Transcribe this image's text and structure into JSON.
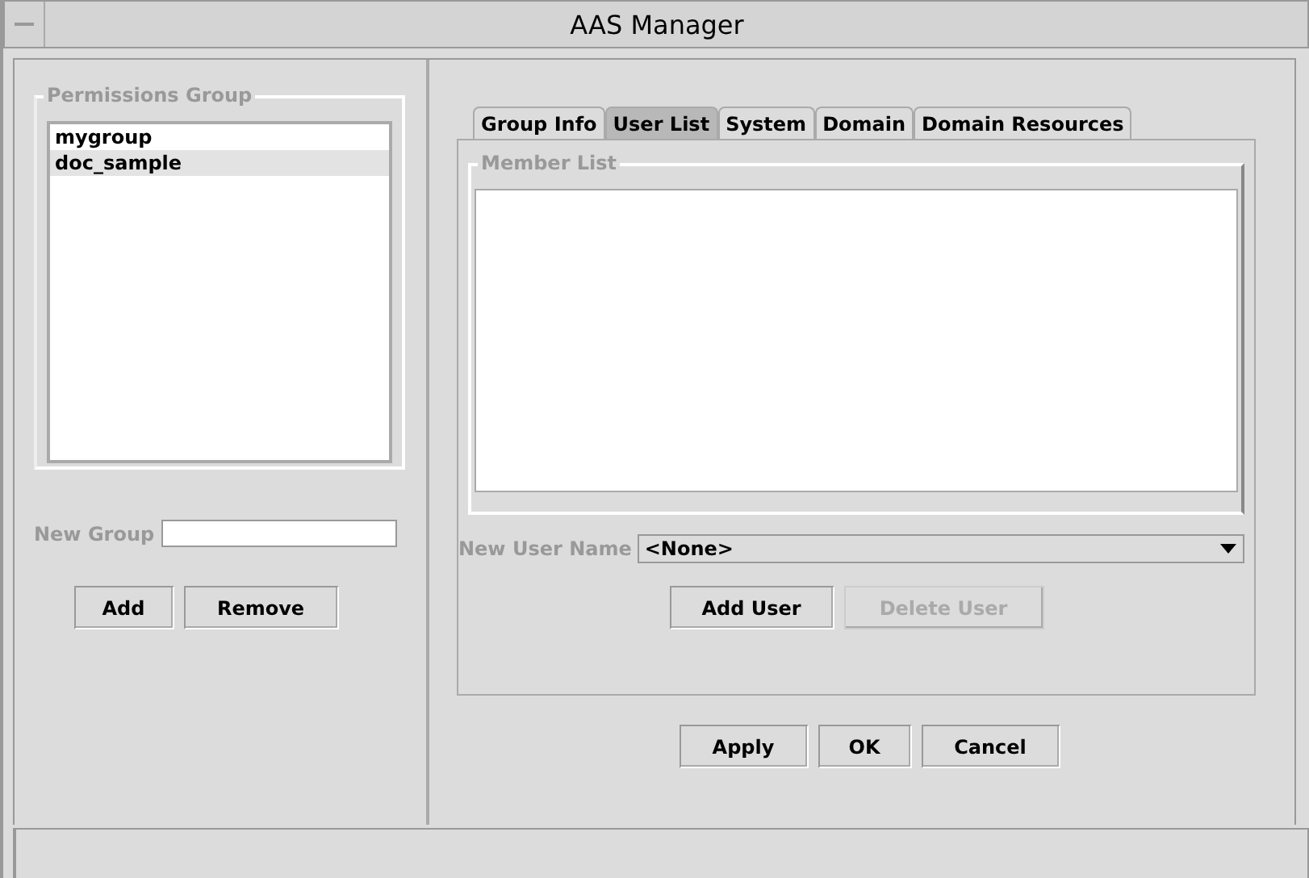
{
  "window": {
    "title": "AAS Manager"
  },
  "permissions_group": {
    "title": "Permissions Group",
    "items": [
      {
        "label": "mygroup",
        "selected": false
      },
      {
        "label": "doc_sample",
        "selected": true
      }
    ],
    "new_group_label": "New Group",
    "buttons": [
      {
        "label": "Add",
        "disabled": false
      },
      {
        "label": "Remove",
        "disabled": false
      }
    ]
  },
  "tabs": [
    {
      "label": "Group Info",
      "selected": false
    },
    {
      "label": "User List",
      "selected": true
    },
    {
      "label": "System",
      "selected": false
    },
    {
      "label": "Domain",
      "selected": false
    },
    {
      "label": "Domain Resources",
      "selected": false
    }
  ],
  "member_list": {
    "title": "Member List",
    "new_user_label": "New User Name",
    "new_user_value": "<None>",
    "buttons": [
      {
        "label": "Add User",
        "disabled": false
      },
      {
        "label": "Delete User",
        "disabled": true
      }
    ]
  },
  "dialog_buttons": [
    {
      "label": "Apply",
      "disabled": false
    },
    {
      "label": "OK",
      "disabled": false
    },
    {
      "label": "Cancel",
      "disabled": false
    }
  ]
}
